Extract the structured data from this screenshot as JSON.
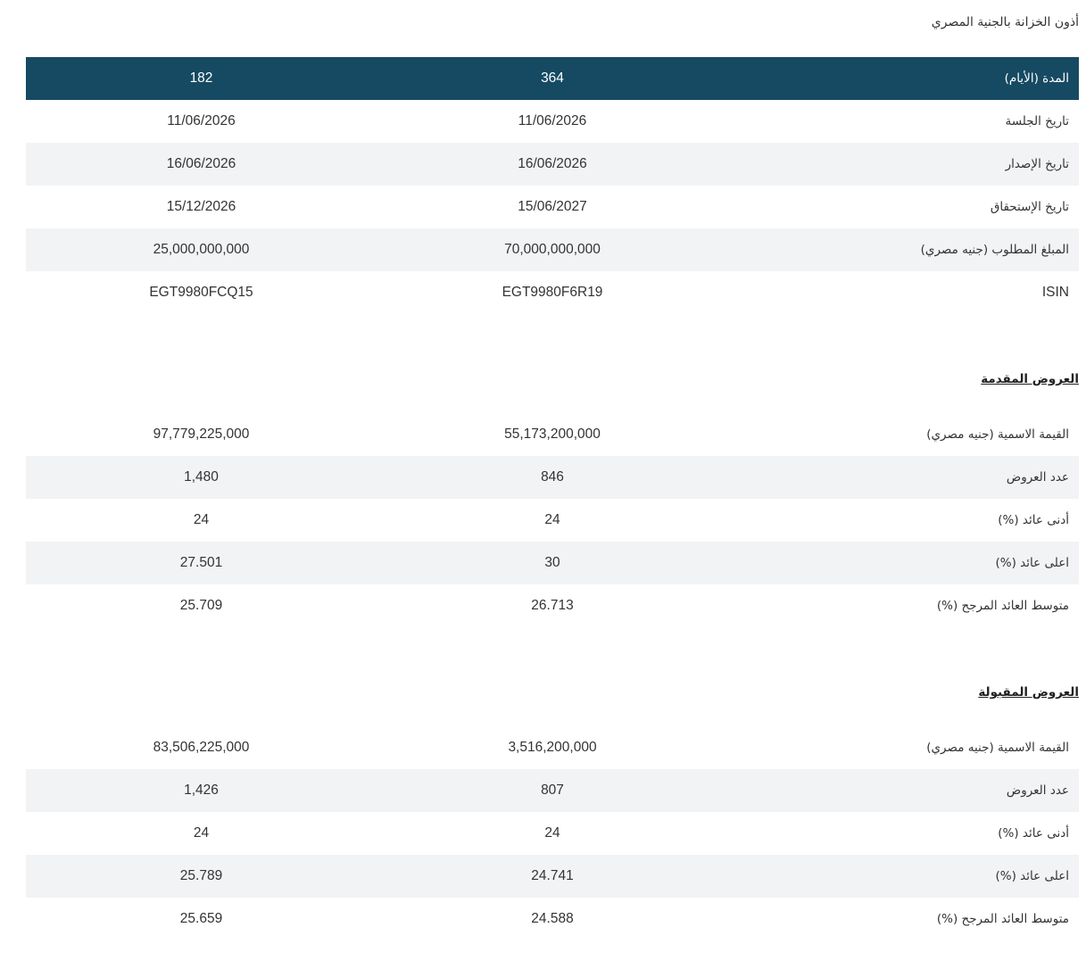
{
  "page": {
    "title": "أذون الخزانة بالجنية المصري"
  },
  "auction": {
    "header": {
      "label": "المدة (الأيام)",
      "tenor_364": "364",
      "tenor_182": "182"
    },
    "rows": [
      {
        "label": "تاريخ الجلسة",
        "tenor_364": "11/06/2026",
        "tenor_182": "11/06/2026"
      },
      {
        "label": "تاريخ الإصدار",
        "tenor_364": "16/06/2026",
        "tenor_182": "16/06/2026"
      },
      {
        "label": "تاريخ الإستحقاق",
        "tenor_364": "15/06/2027",
        "tenor_182": "15/12/2026"
      },
      {
        "label": "المبلغ المطلوب (جنيه مصري)",
        "tenor_364": "70,000,000,000",
        "tenor_182": "25,000,000,000"
      },
      {
        "label": "ISIN",
        "tenor_364": "EGT9980F6R19",
        "tenor_182": "EGT9980FCQ15"
      }
    ]
  },
  "bids_submitted": {
    "heading": "العروض المقدمة",
    "rows": [
      {
        "label": "القيمة الاسمية (جنيه مصري)",
        "tenor_364": "55,173,200,000",
        "tenor_182": "97,779,225,000"
      },
      {
        "label": "عدد العروض",
        "tenor_364": "846",
        "tenor_182": "1,480"
      },
      {
        "label": "أدنى عائد (%)",
        "tenor_364": "24",
        "tenor_182": "24"
      },
      {
        "label": "اعلى عائد (%)",
        "tenor_364": "30",
        "tenor_182": "27.501"
      },
      {
        "label": "متوسط العائد المرجح (%)",
        "tenor_364": "26.713",
        "tenor_182": "25.709"
      }
    ]
  },
  "bids_accepted": {
    "heading": "العروض المقبولة",
    "rows": [
      {
        "label": "القيمة الاسمية (جنيه مصري)",
        "tenor_364": "3,516,200,000",
        "tenor_182": "83,506,225,000"
      },
      {
        "label": "عدد العروض",
        "tenor_364": "807",
        "tenor_182": "1,426"
      },
      {
        "label": "أدنى عائد (%)",
        "tenor_364": "24",
        "tenor_182": "24"
      },
      {
        "label": "اعلى عائد (%)",
        "tenor_364": "24.741",
        "tenor_182": "25.789"
      },
      {
        "label": "متوسط العائد المرجح (%)",
        "tenor_364": "24.588",
        "tenor_182": "25.659"
      }
    ]
  },
  "colors": {
    "header_background": "#154a62",
    "alternate_row": "#f2f3f5"
  }
}
